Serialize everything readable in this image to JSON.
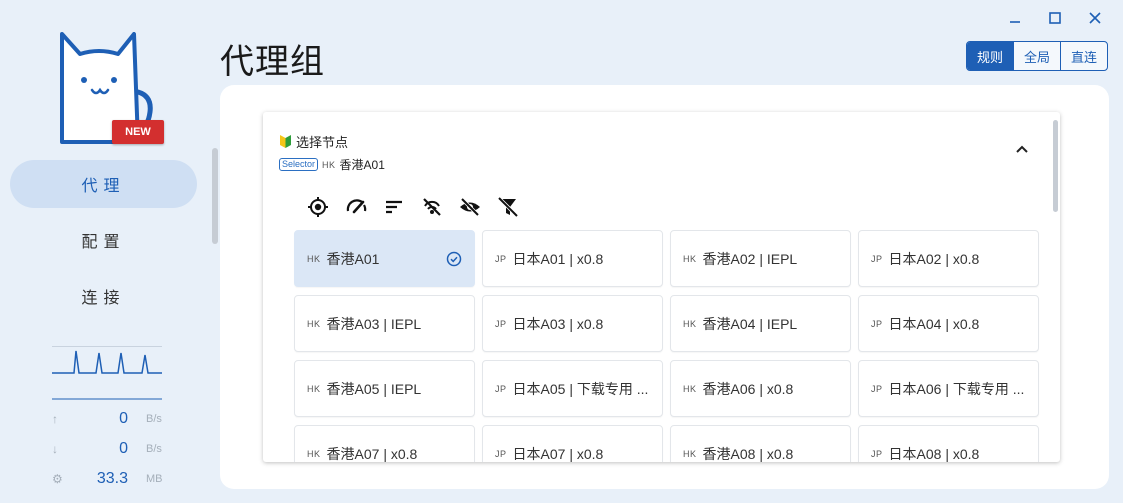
{
  "window": {
    "controls": [
      "minimize-icon",
      "maximize-icon",
      "close-icon"
    ]
  },
  "sidebar": {
    "badge": "NEW",
    "items": [
      {
        "label": "代理",
        "active": true
      },
      {
        "label": "配置",
        "active": false
      },
      {
        "label": "连接",
        "active": false
      }
    ],
    "stats": {
      "upload": {
        "value": "0",
        "unit": "B/s"
      },
      "download": {
        "value": "0",
        "unit": "B/s"
      },
      "memory": {
        "value": "33.3",
        "unit": "MB"
      }
    }
  },
  "header": {
    "title": "代理组",
    "modes": [
      {
        "label": "规则",
        "active": true
      },
      {
        "label": "全局",
        "active": false
      },
      {
        "label": "直连",
        "active": false
      }
    ]
  },
  "group": {
    "icon": "beginner-badge-icon",
    "name": "选择节点",
    "type": "Selector",
    "current_flag": "HK",
    "current": "香港A01",
    "tools": [
      "locate-icon",
      "speed-test-icon",
      "sort-icon",
      "filter-unavailable-icon",
      "hide-icon",
      "filter-off-icon"
    ],
    "nodes": [
      {
        "flag": "HK",
        "name": "香港A01",
        "selected": true
      },
      {
        "flag": "JP",
        "name": "日本A01 | x0.8"
      },
      {
        "flag": "HK",
        "name": "香港A02 | IEPL"
      },
      {
        "flag": "JP",
        "name": "日本A02 | x0.8"
      },
      {
        "flag": "HK",
        "name": "香港A03 | IEPL"
      },
      {
        "flag": "JP",
        "name": "日本A03 | x0.8"
      },
      {
        "flag": "HK",
        "name": "香港A04 | IEPL"
      },
      {
        "flag": "JP",
        "name": "日本A04 | x0.8"
      },
      {
        "flag": "HK",
        "name": "香港A05 | IEPL"
      },
      {
        "flag": "JP",
        "name": "日本A05 | 下载专用 ..."
      },
      {
        "flag": "HK",
        "name": "香港A06 | x0.8"
      },
      {
        "flag": "JP",
        "name": "日本A06 | 下载专用 ..."
      },
      {
        "flag": "HK",
        "name": "香港A07 | x0.8"
      },
      {
        "flag": "JP",
        "name": "日本A07 | x0.8"
      },
      {
        "flag": "HK",
        "name": "香港A08 | x0.8"
      },
      {
        "flag": "JP",
        "name": "日本A08 | x0.8"
      }
    ]
  },
  "colors": {
    "accent": "#1e5fb5",
    "badge": "#d32f2f",
    "background": "#e8f0f9"
  }
}
